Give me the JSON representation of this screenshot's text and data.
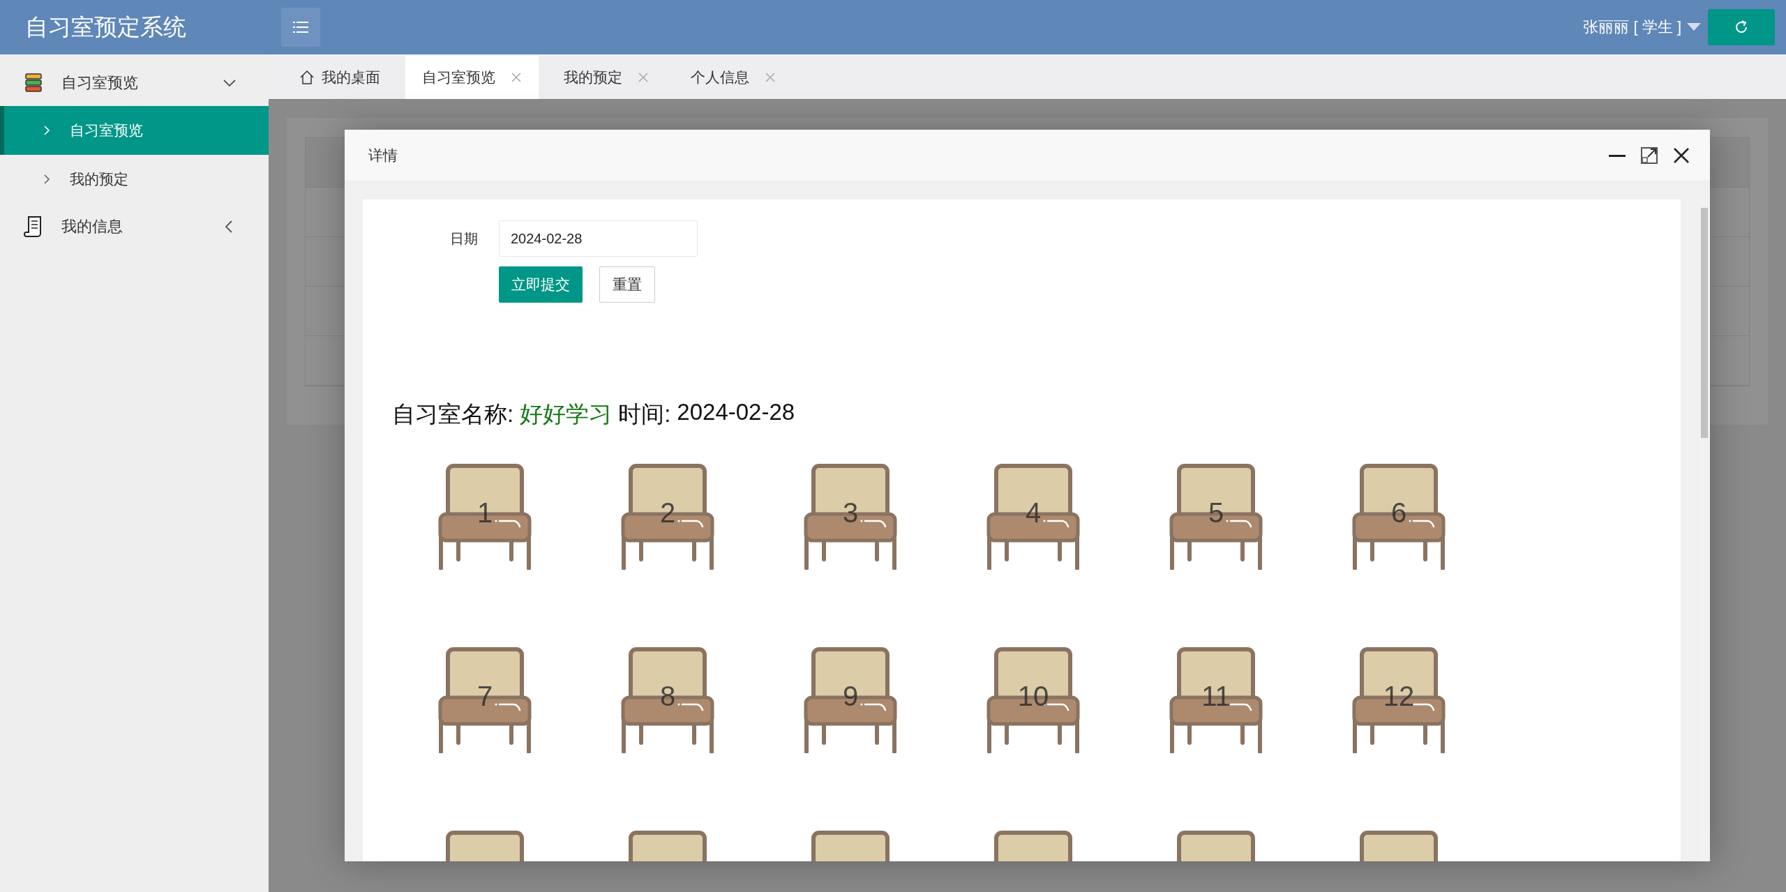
{
  "app_title": "自习室预定系统",
  "user": {
    "name": "张丽丽 [ 学生 ]"
  },
  "sidebar": {
    "items": [
      {
        "label": "自习室预览",
        "expanded": true,
        "children": [
          {
            "label": "自习室预览",
            "selected": true
          },
          {
            "label": "我的预定",
            "selected": false
          }
        ]
      },
      {
        "label": "我的信息",
        "expanded": false
      }
    ]
  },
  "tabs": [
    {
      "label": "我的桌面",
      "kind": "home",
      "selected": false
    },
    {
      "label": "自习室预览",
      "kind": "closable",
      "selected": true
    },
    {
      "label": "我的预定",
      "kind": "closable",
      "selected": false
    },
    {
      "label": "个人信息",
      "kind": "closable",
      "selected": false
    }
  ],
  "dialog": {
    "title": "详情",
    "form": {
      "date_label": "日期",
      "date_value": "2024-02-28",
      "submit": "立即提交",
      "reset": "重置"
    },
    "heading": {
      "name_label": "自习室名称:",
      "room_name": "好好学习",
      "time_label": "时间:",
      "date": "2024-02-28"
    },
    "seats": [
      {
        "kind": "seat",
        "label": "1"
      },
      {
        "kind": "seat",
        "label": "2"
      },
      {
        "kind": "seat",
        "label": "3"
      },
      {
        "kind": "seat",
        "label": "4"
      },
      {
        "kind": "seat",
        "label": "5"
      },
      {
        "kind": "seat",
        "label": "6"
      },
      {
        "kind": "seat",
        "label": "7"
      },
      {
        "kind": "seat",
        "label": "8"
      },
      {
        "kind": "seat",
        "label": "9"
      },
      {
        "kind": "seat",
        "label": "10"
      },
      {
        "kind": "seat",
        "label": "11"
      },
      {
        "kind": "seat",
        "label": "12"
      },
      {
        "kind": "partial"
      },
      {
        "kind": "partial"
      },
      {
        "kind": "partial"
      },
      {
        "kind": "partial"
      },
      {
        "kind": "partial"
      },
      {
        "kind": "partial"
      }
    ]
  }
}
